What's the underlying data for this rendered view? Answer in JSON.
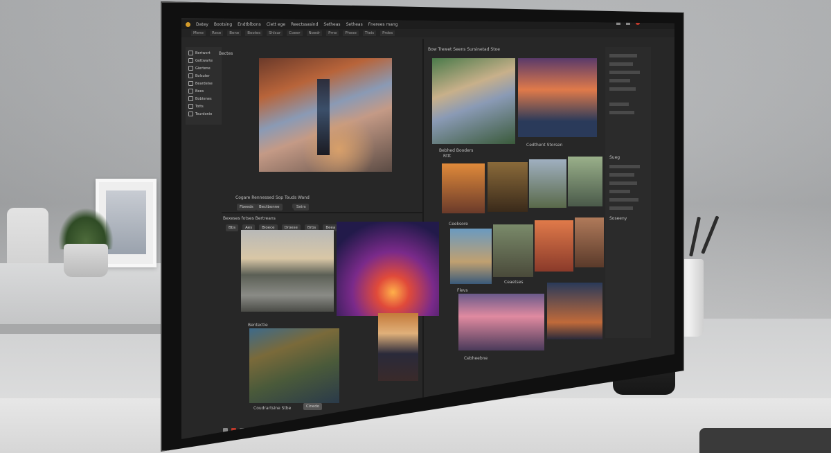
{
  "menu": {
    "items": [
      "Datey",
      "Bootsing",
      "Endtblbons",
      "Ciett ege",
      "Reectssasind",
      "Setheas",
      "Setheas",
      "Fnerees mang"
    ]
  },
  "tabs": [
    "Mene",
    "Rese",
    "Bene",
    "Bootes",
    "Shlsur",
    "Coeer",
    "Noedr",
    "Prne",
    "Phese",
    "Tteis",
    "Prdes"
  ],
  "tools": [
    {
      "label": "Bertwort",
      "icon": "brush-icon"
    },
    {
      "label": "Gottwarte",
      "icon": "lasso-icon"
    },
    {
      "label": "Giertene",
      "icon": "crop-icon"
    },
    {
      "label": "Bolsuter",
      "icon": "layers-icon"
    },
    {
      "label": "Beardelse",
      "icon": "eyedropper-icon"
    },
    {
      "label": "Bees",
      "icon": "stamp-icon"
    },
    {
      "label": "Bobtenes",
      "icon": "eraser-icon"
    },
    {
      "label": "Totts",
      "icon": "text-icon"
    },
    {
      "label": "Teurdonie",
      "icon": "zoom-icon"
    }
  ],
  "center": {
    "header": "Bectes",
    "caption": "Cogare Rennessed Sop Touds Wand",
    "buttons": [
      "Fbeeds",
      "Bectbonne",
      "Sstrs"
    ],
    "lower_header": "Bexeses fotses Bertreans",
    "lower_tabs": [
      "Bbs",
      "Aes",
      "Bioece",
      "Droese",
      "Brbs",
      "Beea"
    ],
    "lower_label": "Bentectie",
    "lower_bar": "Coudrartsine Stbe",
    "lower_bar2": "Cinedo"
  },
  "gallery": {
    "header": "Bow Trewet Seens Sursinetad Stoe",
    "label1": "Bebhed Booders",
    "label1b": "Rttt",
    "label2": "Cedthent Storsen",
    "label3": "Ceeksore",
    "label4": "Ceaetses",
    "label5": "Flevs",
    "label6": "Cebheebne"
  },
  "right_panel": {
    "label": "Sueg",
    "label2": "Soseeny"
  },
  "colors": {
    "accent": "#d49b2a",
    "panel": "#272727",
    "close": "#c0392b"
  }
}
